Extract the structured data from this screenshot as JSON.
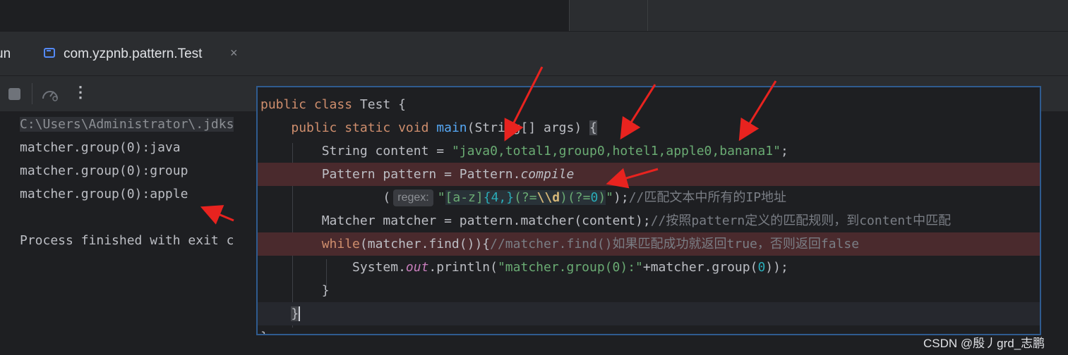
{
  "run_panel": {
    "run_label": "un",
    "tab_title": "com.yzpnb.pattern.Test",
    "tab_close": "×",
    "more_glyph": "⋮",
    "console_lines": [
      "C:\\Users\\Administrator\\.jdks",
      "matcher.group(0):java",
      "matcher.group(0):group",
      "matcher.group(0):apple",
      "",
      "Process finished with exit c"
    ]
  },
  "popup": {
    "lines": [
      [
        [
          "k",
          "public class "
        ],
        [
          "p",
          "Test {"
        ]
      ],
      [
        [
          "p",
          "    "
        ],
        [
          "k",
          "public static void "
        ],
        [
          "f",
          "main"
        ],
        [
          "p",
          "(String[] args) "
        ],
        [
          "brace",
          "{"
        ]
      ],
      [
        [
          "p",
          "        String content = "
        ],
        [
          "s",
          "\"java0,total1,group0,hotel1,apple0,banana1\""
        ],
        [
          "p",
          ";"
        ]
      ],
      [
        [
          "p",
          "        Pattern pattern = Pattern."
        ],
        [
          "it",
          "compile"
        ]
      ],
      [
        [
          "p",
          "                ("
        ],
        [
          "hint",
          "regex:"
        ],
        [
          "s",
          "\""
        ],
        [
          "rx",
          "[a-z]"
        ],
        [
          "rxc",
          "{4,}"
        ],
        [
          "rx",
          "(?="
        ],
        [
          "rxe",
          "\\\\d"
        ],
        [
          "rx",
          ")(?="
        ],
        [
          "rxc",
          "0"
        ],
        [
          "rx",
          ")"
        ],
        [
          "s",
          "\""
        ],
        [
          "p",
          ");"
        ],
        [
          "c",
          "//匹配文本中所有的IP地址"
        ]
      ],
      [
        [
          "p",
          "        Matcher matcher = pattern.matcher(content);"
        ],
        [
          "c",
          "//按照pattern定义的匹配规则，到content中匹配"
        ]
      ],
      [
        [
          "p",
          "        "
        ],
        [
          "k",
          "while"
        ],
        [
          "p",
          "(matcher.find()){"
        ],
        [
          "c",
          "//matcher.find()如果匹配成功就返回true，否则返回false"
        ]
      ],
      [
        [
          "p",
          "            System."
        ],
        [
          "i",
          "out"
        ],
        [
          "p",
          ".println("
        ],
        [
          "s",
          "\"matcher.group(0):\""
        ],
        [
          "p",
          "+matcher.group("
        ],
        [
          "n",
          "0"
        ],
        [
          "p",
          "));"
        ]
      ],
      [
        [
          "p",
          "        }"
        ]
      ],
      [
        [
          "p",
          "    "
        ],
        [
          "caret",
          "}"
        ]
      ],
      [
        [
          "p",
          "}"
        ]
      ]
    ]
  },
  "watermark": "CSDN @殷丿grd_志鹏",
  "colors": {
    "keyword": "#cf8e6d",
    "string": "#6aab73",
    "number": "#2aacb8",
    "function": "#56a8f5",
    "comment": "#7a7e85",
    "annotation_arrow": "#e8231f"
  }
}
